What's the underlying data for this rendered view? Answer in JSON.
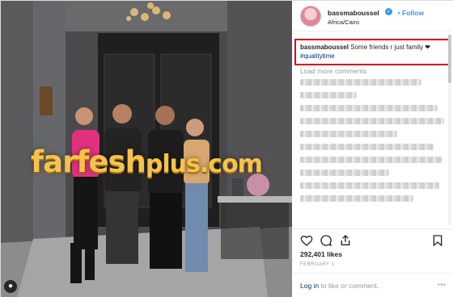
{
  "post": {
    "username": "bassmaboussel",
    "verified_icon": "verified-badge-icon",
    "follow_label": "Follow",
    "location": "Africa/Cairo",
    "caption_user": "bassmaboussel",
    "caption_text": "Some friends r just family ❤",
    "hashtag": "#qualitytime",
    "load_more": "Load more comments",
    "likes": "292,401 likes",
    "date": "FEBRUARY 1",
    "login_link": "Log in",
    "login_rest": " to like or comment."
  },
  "watermark": {
    "main": "farfesh",
    "suffix": "plus.com"
  },
  "icons": [
    "heart-icon",
    "comment-icon",
    "share-icon",
    "bookmark-icon",
    "user-tag-icon"
  ],
  "colors": {
    "accent": "#3897f0",
    "highlight_border": "#d9001b",
    "watermark": "#f6c24a"
  }
}
